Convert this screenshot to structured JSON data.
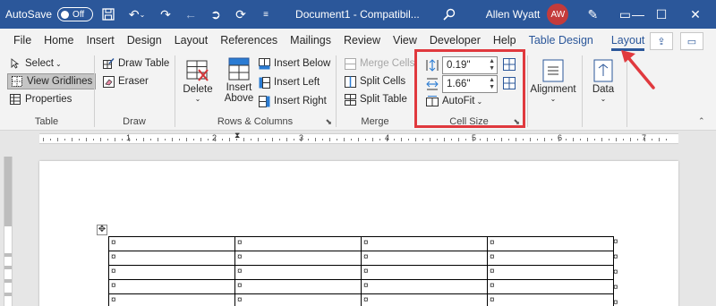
{
  "titlebar": {
    "autosave_label": "AutoSave",
    "autosave_state": "Off",
    "doc_title": "Document1  -  Compatibil...",
    "user_name": "Allen Wyatt",
    "user_initials": "AW"
  },
  "tabs": [
    "File",
    "Home",
    "Insert",
    "Design",
    "Layout",
    "References",
    "Mailings",
    "Review",
    "View",
    "Developer",
    "Help",
    "Table Design",
    "Layout"
  ],
  "active_tab": "Layout",
  "ribbon": {
    "table": {
      "label": "Table",
      "select": "Select",
      "view_gridlines": "View Gridlines",
      "properties": "Properties"
    },
    "draw": {
      "label": "Draw",
      "draw_table": "Draw Table",
      "eraser": "Eraser"
    },
    "rows_columns": {
      "label": "Rows & Columns",
      "delete": "Delete",
      "insert_above_1": "Insert",
      "insert_above_2": "Above",
      "insert_below": "Insert Below",
      "insert_left": "Insert Left",
      "insert_right": "Insert Right"
    },
    "merge": {
      "label": "Merge",
      "merge_cells": "Merge Cells",
      "split_cells": "Split Cells",
      "split_table": "Split Table"
    },
    "cell_size": {
      "label": "Cell Size",
      "height_value": "0.19\"",
      "width_value": "1.66\"",
      "autofit": "AutoFit"
    },
    "alignment": {
      "label": "Alignment"
    },
    "data": {
      "label": "Data"
    }
  },
  "ruler": {
    "numbers": [
      "1",
      "2",
      "3",
      "4",
      "5",
      "6",
      "7"
    ]
  },
  "document": {
    "cell_mark": "¤",
    "rows": 5,
    "cols": 4
  },
  "colors": {
    "titlebar": "#2b579a",
    "annotation": "#e0393e",
    "avatar": "#c43b3b"
  }
}
